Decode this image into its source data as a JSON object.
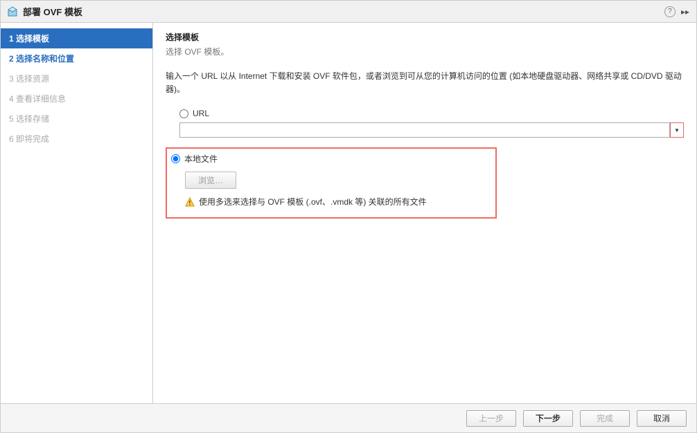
{
  "titlebar": {
    "title": "部署 OVF 模板",
    "help_tooltip": "?"
  },
  "sidebar": {
    "steps": [
      {
        "num": "1",
        "label": "选择模板",
        "state": "active"
      },
      {
        "num": "2",
        "label": "选择名称和位置",
        "state": "enabled"
      },
      {
        "num": "3",
        "label": "选择资源",
        "state": "disabled"
      },
      {
        "num": "4",
        "label": "查看详细信息",
        "state": "disabled"
      },
      {
        "num": "5",
        "label": "选择存储",
        "state": "disabled"
      },
      {
        "num": "6",
        "label": "即将完成",
        "state": "disabled"
      }
    ]
  },
  "main": {
    "section_title": "选择模板",
    "section_subtitle": "选择 OVF 模板。",
    "instructions": "输入一个 URL 以从 Internet 下载和安装 OVF 软件包，或者浏览到可从您的计算机访问的位置 (如本地硬盘驱动器、网络共享或 CD/DVD 驱动器)。",
    "url_option_label": "URL",
    "url_value": "",
    "local_option_label": "本地文件",
    "browse_label": "浏览…",
    "warning_text": "使用多选来选择与 OVF 模板 (.ovf、.vmdk 等) 关联的所有文件",
    "selected_option": "local"
  },
  "footer": {
    "back": "上一步",
    "next": "下一步",
    "finish": "完成",
    "cancel": "取消"
  }
}
